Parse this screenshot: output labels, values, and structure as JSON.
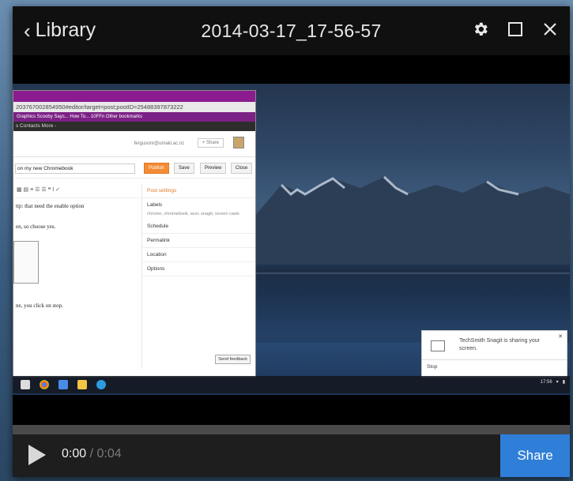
{
  "titlebar": {
    "back_label": "Library",
    "title": "2014-03-17_17-56-57",
    "icons": [
      "gear-icon",
      "maximize-icon",
      "close-icon"
    ]
  },
  "recording": {
    "browser": {
      "url": "203767002854950#editor/target=post;postID=25488397873222",
      "bookmarks": "Graphics   Scooby Says...   How To...   10FFn                      Other bookmarks",
      "nav": "s  Contacts  More -",
      "email": "fergusonr@umaki.ac.nz",
      "share_label": "+ Share",
      "post_title": "on my new Chromebook",
      "publish_label": "Publish",
      "save_label": "Save",
      "preview_label": "Preview",
      "close_label": "Close",
      "editor_lines": [
        "ttp: that need the enable option",
        "en, so choose yes.",
        "ne, you click on stop."
      ],
      "post_settings": "Post settings",
      "labels_label": "Labels",
      "labels_value": "chrome, chromebook, acer, snagit, screen casts",
      "schedule_label": "Schedule",
      "permalink_label": "Permalink",
      "location_label": "Location",
      "options_label": "Options",
      "send_feedback": "Send feedback"
    },
    "notification": {
      "text": "TechSmith Snagit is sharing your screen.",
      "stop_label": "Stop"
    },
    "tray_time": "17:56"
  },
  "player": {
    "current_time": "0:00",
    "duration": "/ 0:04",
    "share_label": "Share",
    "progress": 0
  }
}
